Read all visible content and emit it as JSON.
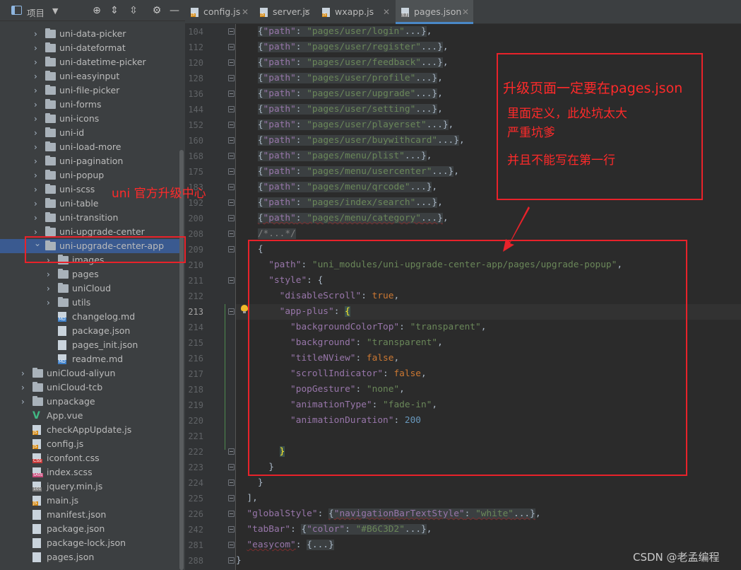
{
  "sidebar": {
    "title": "项目",
    "caret": "▼",
    "toolbar": {
      "locate": "⊕",
      "expand": "⇕",
      "collapse": "⇳",
      "settings": "⚙",
      "hide": "—"
    },
    "items": [
      {
        "label": "uni-data-picker",
        "type": "folder",
        "depth": 2,
        "expanded": false
      },
      {
        "label": "uni-dateformat",
        "type": "folder",
        "depth": 2,
        "expanded": false
      },
      {
        "label": "uni-datetime-picker",
        "type": "folder",
        "depth": 2,
        "expanded": false
      },
      {
        "label": "uni-easyinput",
        "type": "folder",
        "depth": 2,
        "expanded": false
      },
      {
        "label": "uni-file-picker",
        "type": "folder",
        "depth": 2,
        "expanded": false
      },
      {
        "label": "uni-forms",
        "type": "folder",
        "depth": 2,
        "expanded": false
      },
      {
        "label": "uni-icons",
        "type": "folder",
        "depth": 2,
        "expanded": false
      },
      {
        "label": "uni-id",
        "type": "folder",
        "depth": 2,
        "expanded": false
      },
      {
        "label": "uni-load-more",
        "type": "folder",
        "depth": 2,
        "expanded": false
      },
      {
        "label": "uni-pagination",
        "type": "folder",
        "depth": 2,
        "expanded": false
      },
      {
        "label": "uni-popup",
        "type": "folder",
        "depth": 2,
        "expanded": false
      },
      {
        "label": "uni-scss",
        "type": "folder",
        "depth": 2,
        "expanded": false
      },
      {
        "label": "uni-table",
        "type": "folder",
        "depth": 2,
        "expanded": false
      },
      {
        "label": "uni-transition",
        "type": "folder",
        "depth": 2,
        "expanded": false
      },
      {
        "label": "uni-upgrade-center",
        "type": "folder",
        "depth": 2,
        "expanded": false
      },
      {
        "label": "uni-upgrade-center-app",
        "type": "folder",
        "depth": 2,
        "expanded": true,
        "selected": true
      },
      {
        "label": "images",
        "type": "folder",
        "depth": 3,
        "expanded": false
      },
      {
        "label": "pages",
        "type": "folder",
        "depth": 3,
        "expanded": false
      },
      {
        "label": "uniCloud",
        "type": "folder",
        "depth": 3,
        "expanded": false
      },
      {
        "label": "utils",
        "type": "folder",
        "depth": 3,
        "expanded": false
      },
      {
        "label": "changelog.md",
        "type": "md",
        "depth": 3
      },
      {
        "label": "package.json",
        "type": "json",
        "depth": 3
      },
      {
        "label": "pages_init.json",
        "type": "json",
        "depth": 3
      },
      {
        "label": "readme.md",
        "type": "md",
        "depth": 3
      },
      {
        "label": "uniCloud-aliyun",
        "type": "folder",
        "depth": 1,
        "expanded": false
      },
      {
        "label": "uniCloud-tcb",
        "type": "folder",
        "depth": 1,
        "expanded": false
      },
      {
        "label": "unpackage",
        "type": "folder",
        "depth": 1,
        "expanded": false
      },
      {
        "label": "App.vue",
        "type": "vue",
        "depth": 1
      },
      {
        "label": "checkAppUpdate.js",
        "type": "js",
        "depth": 1
      },
      {
        "label": "config.js",
        "type": "js",
        "depth": 1
      },
      {
        "label": "iconfont.css",
        "type": "css",
        "depth": 1
      },
      {
        "label": "index.scss",
        "type": "sass",
        "depth": 1
      },
      {
        "label": "jquery.min.js",
        "type": "lib",
        "depth": 1
      },
      {
        "label": "main.js",
        "type": "js",
        "depth": 1
      },
      {
        "label": "manifest.json",
        "type": "json",
        "depth": 1
      },
      {
        "label": "package.json",
        "type": "json",
        "depth": 1
      },
      {
        "label": "package-lock.json",
        "type": "json",
        "depth": 1
      },
      {
        "label": "pages.json",
        "type": "json",
        "depth": 1
      }
    ]
  },
  "tabs": [
    {
      "label": "config.js",
      "icon": "js",
      "active": false
    },
    {
      "label": "server.js",
      "icon": "js",
      "active": false
    },
    {
      "label": "wxapp.js",
      "icon": "js",
      "active": false
    },
    {
      "label": "pages.json",
      "icon": "json",
      "active": true
    }
  ],
  "tab_close": "✕",
  "editor": {
    "lines": [
      {
        "n": "104",
        "fold": true,
        "html": "    <span class='fb'>{<span class='k'>\"path\"</span>: <span class='s'>\"pages/user/login\"</span>...}</span>,"
      },
      {
        "n": "112",
        "fold": true,
        "html": "    <span class='fb'>{<span class='k'>\"path\"</span>: <span class='s'>\"pages/user/register\"</span>...}</span>,"
      },
      {
        "n": "120",
        "fold": true,
        "html": "    <span class='fb'>{<span class='k'>\"path\"</span>: <span class='s'>\"pages/user/feedback\"</span>...}</span>,"
      },
      {
        "n": "128",
        "fold": true,
        "html": "    <span class='fb'>{<span class='k'>\"path\"</span>: <span class='s'>\"pages/user/profile\"</span>...}</span>,"
      },
      {
        "n": "136",
        "fold": true,
        "html": "    <span class='fb'>{<span class='k'>\"path\"</span>: <span class='s'>\"pages/user/upgrade\"</span>...}</span>,"
      },
      {
        "n": "144",
        "fold": true,
        "html": "    <span class='fb'>{<span class='k'>\"path\"</span>: <span class='s'>\"pages/user/setting\"</span>...}</span>,"
      },
      {
        "n": "152",
        "fold": true,
        "html": "    <span class='fb'>{<span class='k'>\"path\"</span>: <span class='s'>\"pages/user/playerset\"</span>...}</span>,"
      },
      {
        "n": "160",
        "fold": true,
        "html": "    <span class='fb'>{<span class='k'>\"path\"</span>: <span class='s'>\"pages/user/buywithcard\"</span>...}</span>,"
      },
      {
        "n": "168",
        "fold": true,
        "html": "    <span class='fb'>{<span class='k'>\"path\"</span>: <span class='s'>\"pages/menu/plist\"</span>...}</span>,"
      },
      {
        "n": "175",
        "fold": true,
        "html": "    <span class='fb'>{<span class='k'>\"path\"</span>: <span class='s'>\"pages/menu/usercenter\"</span>...}</span>,"
      },
      {
        "n": "183",
        "fold": true,
        "html": "    <span class='fb'>{<span class='k'>\"path\"</span>: <span class='s'>\"pages/menu/qrcode\"</span>...}</span>,"
      },
      {
        "n": "192",
        "fold": true,
        "html": "    <span class='fb'>{<span class='k'>\"path\"</span>: <span class='s'>\"pages/index/search\"</span>...}</span>,"
      },
      {
        "n": "200",
        "fold": true,
        "html": "    <span class='fb wavy'>{<span class='k'>\"path\"</span>: <span class='s'>\"pages/menu/category\"</span>...}</span>,"
      },
      {
        "n": "208",
        "fold": true,
        "html": "    <span class='fb cm'>/*...*/</span>"
      },
      {
        "n": "209",
        "fold": true,
        "html": "    {"
      },
      {
        "n": "210",
        "fold": false,
        "html": "      <span class='k'>\"path\"</span>: <span class='s'>\"uni_modules/uni-upgrade-center-app/pages/upgrade-popup\"</span>,"
      },
      {
        "n": "211",
        "fold": true,
        "html": "      <span class='k'>\"style\"</span>: {"
      },
      {
        "n": "212",
        "fold": false,
        "html": "        <span class='k'>\"disableScroll\"</span>: <span class='kw'>true</span>,"
      },
      {
        "n": "213",
        "fold": true,
        "cur": true,
        "html": "        <span class='k'>\"app-plus\"</span>: <span class='brk'>{</span>"
      },
      {
        "n": "214",
        "fold": false,
        "html": "          <span class='k'>\"backgroundColorTop\"</span>: <span class='s'>\"transparent\"</span>,"
      },
      {
        "n": "215",
        "fold": false,
        "html": "          <span class='k'>\"background\"</span>: <span class='s'>\"transparent\"</span>,"
      },
      {
        "n": "216",
        "fold": false,
        "html": "          <span class='k'>\"titleNView\"</span>: <span class='kw'>false</span>,"
      },
      {
        "n": "217",
        "fold": false,
        "html": "          <span class='k'>\"scrollIndicator\"</span>: <span class='kw'>false</span>,"
      },
      {
        "n": "218",
        "fold": false,
        "html": "          <span class='k'>\"popGesture\"</span>: <span class='s'>\"none\"</span>,"
      },
      {
        "n": "219",
        "fold": false,
        "html": "          <span class='k'>\"animationType\"</span>: <span class='s'>\"fade-in\"</span>,"
      },
      {
        "n": "220",
        "fold": false,
        "html": "          <span class='k'>\"animationDuration\"</span>: <span class='n'>200</span>"
      },
      {
        "n": "221",
        "fold": false,
        "html": ""
      },
      {
        "n": "222",
        "fold": true,
        "html": "        <span class='brk'>}</span>"
      },
      {
        "n": "223",
        "fold": true,
        "html": "      }"
      },
      {
        "n": "224",
        "fold": true,
        "html": "    }"
      },
      {
        "n": "225",
        "fold": true,
        "html": "  ],"
      },
      {
        "n": "226",
        "fold": true,
        "html": "  <span class='k'>\"globalStyle\"</span>: <span class='fb wavy'>{<span class='k'>\"navigationBarTextStyle\"</span>: <span class='s'>\"white\"</span>...}</span>,"
      },
      {
        "n": "242",
        "fold": true,
        "html": "  <span class='k'>\"tabBar\"</span>: <span class='fb'>{<span class='k'>\"color\"</span>: <span class='s'>\"#B6C3D2\"</span>...}</span>,"
      },
      {
        "n": "281",
        "fold": true,
        "html": "  <span class='k wavy'>\"easycom\"</span>: <span class='fb'>{...}</span>"
      },
      {
        "n": "288",
        "fold": true,
        "html": "}"
      }
    ]
  },
  "annotations": {
    "sidebar_note": "uni 官方升级中心",
    "note_line1": "升级页面一定要在pages.json",
    "note_line2": "里面定义，此处坑太大",
    "note_line3": "严重坑爹",
    "note_line4": "并且不能写在第一行"
  },
  "watermark": "CSDN @老孟编程",
  "colors": {
    "annotation": "#e8222a",
    "selection": "#3a5a90",
    "accent": "#4a88c7"
  }
}
